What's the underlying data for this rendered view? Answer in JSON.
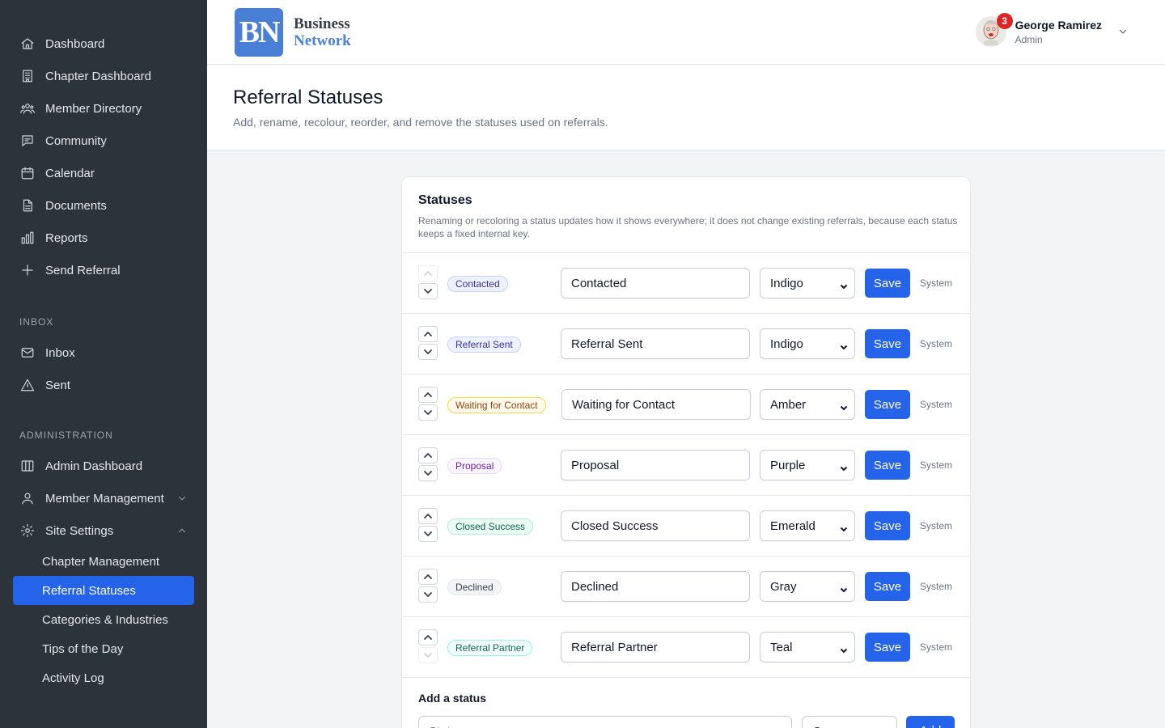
{
  "sidebar": {
    "main": [
      {
        "label": "Dashboard",
        "icon": "home-icon"
      },
      {
        "label": "Chapter Dashboard",
        "icon": "building-icon"
      },
      {
        "label": "Member Directory",
        "icon": "users-icon"
      },
      {
        "label": "Community",
        "icon": "chat-icon"
      },
      {
        "label": "Calendar",
        "icon": "calendar-icon"
      },
      {
        "label": "Documents",
        "icon": "document-icon"
      },
      {
        "label": "Reports",
        "icon": "chart-icon"
      },
      {
        "label": "Send Referral",
        "icon": "plus-icon"
      }
    ],
    "inbox_label": "INBOX",
    "inbox": [
      {
        "label": "Inbox",
        "icon": "envelope-icon"
      },
      {
        "label": "Sent",
        "icon": "send-icon"
      }
    ],
    "admin_label": "ADMINISTRATION",
    "admin": [
      {
        "label": "Admin Dashboard",
        "icon": "columns-icon"
      },
      {
        "label": "Member Management",
        "icon": "user-icon"
      },
      {
        "label": "Site Settings",
        "icon": "gear-icon"
      }
    ],
    "settings_sub": [
      {
        "label": "Chapter Management"
      },
      {
        "label": "Referral Statuses",
        "active": true
      },
      {
        "label": "Categories & Industries"
      },
      {
        "label": "Tips of the Day"
      },
      {
        "label": "Activity Log"
      }
    ]
  },
  "header": {
    "logo_mark": "BN",
    "logo_line1": "Business",
    "logo_line2": "Network",
    "notification_count": "3",
    "user_name": "George Ramirez",
    "user_role": "Admin"
  },
  "page": {
    "title": "Referral Statuses",
    "subtitle": "Add, rename, recolour, reorder, and remove the statuses used on referrals."
  },
  "card": {
    "title": "Statuses",
    "description": "Renaming or recoloring a status updates how it shows everywhere; it does not change existing referrals, because each status keeps a fixed internal key."
  },
  "statuses": [
    {
      "label": "Contacted",
      "name": "Contacted",
      "color": "Indigo",
      "save": "Save",
      "type": "System"
    },
    {
      "label": "Referral Sent",
      "name": "Referral Sent",
      "color": "Indigo",
      "save": "Save",
      "type": "System"
    },
    {
      "label": "Waiting for Contact",
      "name": "Waiting for Contact",
      "color": "Amber",
      "save": "Save",
      "type": "System"
    },
    {
      "label": "Proposal",
      "name": "Proposal",
      "color": "Purple",
      "save": "Save",
      "type": "System"
    },
    {
      "label": "Closed Success",
      "name": "Closed Success",
      "color": "Emerald",
      "save": "Save",
      "type": "System"
    },
    {
      "label": "Declined",
      "name": "Declined",
      "color": "Gray",
      "save": "Save",
      "type": "System"
    },
    {
      "label": "Referral Partner",
      "name": "Referral Partner",
      "color": "Teal",
      "save": "Save",
      "type": "System"
    }
  ],
  "pill_colors": {
    "Indigo": {
      "bg": "#eef2ff",
      "border": "#c7d2fe",
      "text": "#3730a3"
    },
    "Amber": {
      "bg": "#fffbeb",
      "border": "#fcd34d",
      "text": "#92400e"
    },
    "Purple": {
      "bg": "#faf5ff",
      "border": "#e9d5ff",
      "text": "#6b21a8"
    },
    "Emerald": {
      "bg": "#ecfdf5",
      "border": "#a7f3d0",
      "text": "#065f46"
    },
    "Gray": {
      "bg": "#f3f4f6",
      "border": "#e5e7eb",
      "text": "#374151"
    },
    "Teal": {
      "bg": "#f0fdfa",
      "border": "#99f6e4",
      "text": "#115e59"
    }
  },
  "add": {
    "title": "Add a status",
    "placeholder": "Status name",
    "color": "Gray",
    "button": "Add"
  }
}
